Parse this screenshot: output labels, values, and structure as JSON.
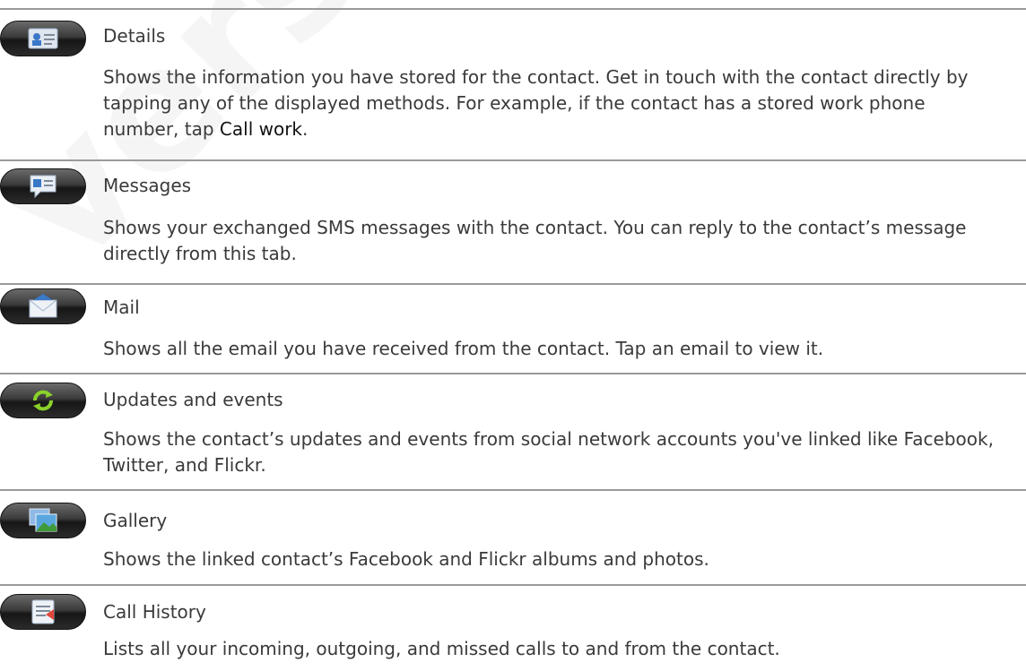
{
  "items": [
    {
      "icon": "contact-card-icon",
      "title": "Details",
      "desc_before": "Shows the information you have stored for the contact. Get in touch with the contact directly by tapping any of the displayed methods. For example, if the contact has a stored work phone number, tap ",
      "desc_highlight": "Call work",
      "desc_after": "."
    },
    {
      "icon": "message-bubble-icon",
      "title": "Messages",
      "desc": "Shows your exchanged SMS messages with the contact. You can reply to the contact’s message directly from this tab."
    },
    {
      "icon": "mail-envelope-icon",
      "title": "Mail",
      "desc": "Shows all the email you have received from the contact. Tap an email to view it."
    },
    {
      "icon": "refresh-arrows-icon",
      "title": "Updates and events",
      "desc": "Shows the contact’s updates and events from social network accounts you've linked like Facebook, Twitter, and Flickr."
    },
    {
      "icon": "gallery-photo-icon",
      "title": "Gallery",
      "desc": "Shows the linked contact’s Facebook and Flickr albums and photos."
    },
    {
      "icon": "call-history-icon",
      "title": "Call History",
      "desc": "Lists all your incoming, outgoing, and missed calls to and from the contact."
    }
  ],
  "watermark": "version for"
}
